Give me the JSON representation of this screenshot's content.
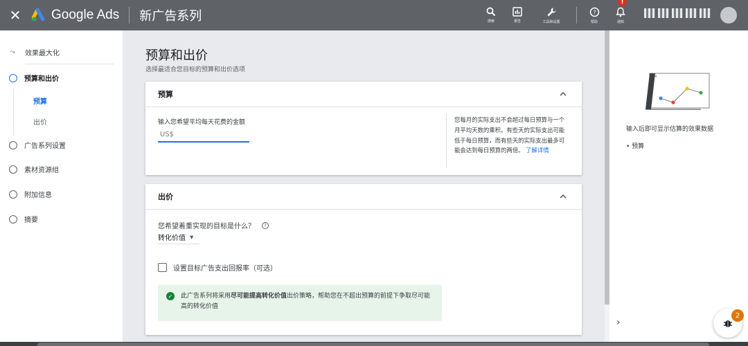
{
  "topbar": {
    "close_icon": "close-icon",
    "product_name": "Google Ads",
    "campaign_title": "新广告系列",
    "actions": [
      {
        "icon": "search-icon",
        "label": "搜索"
      },
      {
        "icon": "reports-icon",
        "label": "报告"
      },
      {
        "icon": "wrench-icon",
        "label": "工具和设置"
      },
      {
        "icon": "help-icon",
        "label": "帮助"
      },
      {
        "icon": "bell-icon",
        "label": "通知",
        "badge": "!"
      }
    ]
  },
  "sidebar": {
    "items": [
      {
        "label": "效果最大化",
        "icon": "trend-icon"
      },
      {
        "label": "预算和出价",
        "active": true
      },
      {
        "label": "广告系列设置"
      },
      {
        "label": "素材资源组"
      },
      {
        "label": "附加信息"
      },
      {
        "label": "摘要"
      }
    ],
    "sub_items": [
      {
        "label": "预算",
        "active": true
      },
      {
        "label": "出价"
      }
    ]
  },
  "main": {
    "title": "预算和出价",
    "subtitle": "选择最适合您目标的预算和出价选项",
    "budget_card": {
      "header": "预算",
      "field_label": "输入您希望平均每天花费的金额",
      "currency_placeholder": "US$",
      "help_text": "您每月的实际支出不会超过每日预算与一个月平均天数的乘积。有些天的实际支出可能低于每日预算，而有些天的实际支出最多可能会达到每日预算的两倍。",
      "learn_more": "了解详情"
    },
    "bidding_card": {
      "header": "出价",
      "question": "您希望着重实现的目标是什么？",
      "selected_option": "转化价值",
      "checkbox_label": "设置目标广告支出回报率（可选）",
      "alert_text_before": "此广告系列将采用",
      "alert_text_bold": "尽可能提高转化价值",
      "alert_text_after": "出价策略，帮助您在不超出预算的前提下争取尽可能高的转化价值"
    }
  },
  "right_panel": {
    "estimate_text": "输入后即可显示估算的效果数据",
    "bullet": "预算"
  },
  "fab": {
    "badge_count": "2"
  },
  "colors": {
    "topbar": "#5f6368",
    "accent": "#1a73e8",
    "success_bg": "#e6f4ea",
    "success": "#188038",
    "badge_orange": "#e37400",
    "notification_red": "#d93025"
  }
}
